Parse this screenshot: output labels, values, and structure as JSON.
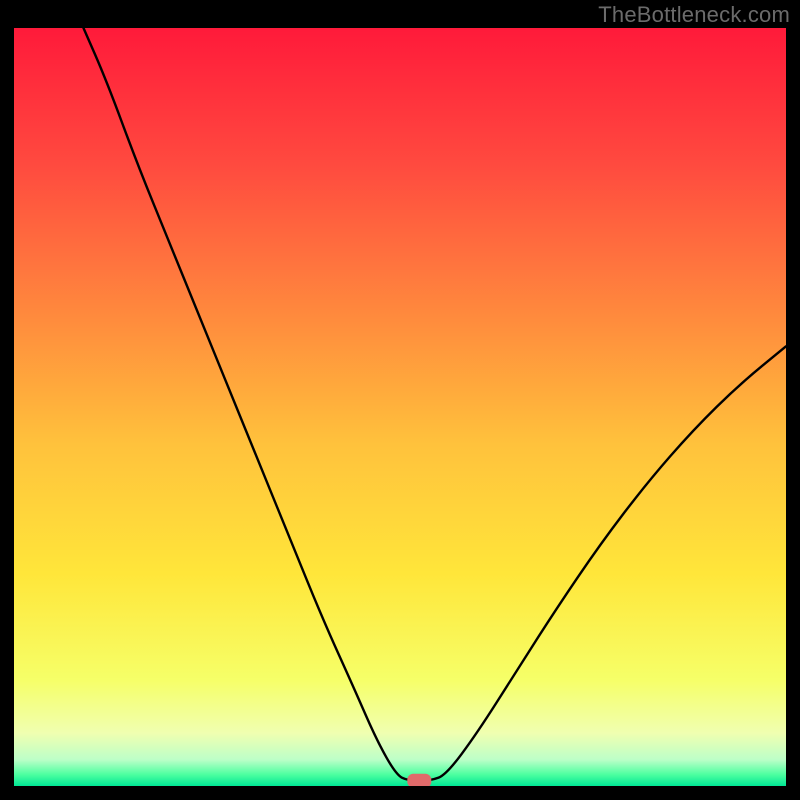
{
  "watermark": "TheBottleneck.com",
  "chart_data": {
    "type": "line",
    "title": "",
    "xlabel": "",
    "ylabel": "",
    "xlim": [
      0,
      100
    ],
    "ylim": [
      0,
      100
    ],
    "gradient_stops": [
      {
        "offset": 0.0,
        "color": "#ff1a3a"
      },
      {
        "offset": 0.18,
        "color": "#ff4a3f"
      },
      {
        "offset": 0.38,
        "color": "#ff8a3d"
      },
      {
        "offset": 0.55,
        "color": "#ffc23c"
      },
      {
        "offset": 0.72,
        "color": "#ffe63a"
      },
      {
        "offset": 0.86,
        "color": "#f6ff68"
      },
      {
        "offset": 0.93,
        "color": "#f0ffb0"
      },
      {
        "offset": 0.965,
        "color": "#bdffc8"
      },
      {
        "offset": 0.985,
        "color": "#4cffa0"
      },
      {
        "offset": 1.0,
        "color": "#00e695"
      }
    ],
    "series": [
      {
        "name": "bottleneck-curve",
        "points": [
          {
            "x": 9,
            "y": 100
          },
          {
            "x": 12,
            "y": 93
          },
          {
            "x": 16,
            "y": 82
          },
          {
            "x": 20,
            "y": 72
          },
          {
            "x": 24,
            "y": 62
          },
          {
            "x": 28,
            "y": 52
          },
          {
            "x": 32,
            "y": 42
          },
          {
            "x": 36,
            "y": 32
          },
          {
            "x": 40,
            "y": 22
          },
          {
            "x": 44,
            "y": 13
          },
          {
            "x": 47,
            "y": 6
          },
          {
            "x": 49.5,
            "y": 1.5
          },
          {
            "x": 51,
            "y": 0.7
          },
          {
            "x": 54,
            "y": 0.7
          },
          {
            "x": 56,
            "y": 1.5
          },
          {
            "x": 60,
            "y": 7
          },
          {
            "x": 65,
            "y": 15
          },
          {
            "x": 70,
            "y": 23
          },
          {
            "x": 76,
            "y": 32
          },
          {
            "x": 82,
            "y": 40
          },
          {
            "x": 88,
            "y": 47
          },
          {
            "x": 94,
            "y": 53
          },
          {
            "x": 100,
            "y": 58
          }
        ]
      }
    ],
    "marker": {
      "x": 52.5,
      "y": 0.7,
      "color": "#e06a6a"
    },
    "colors": {
      "curve": "#000000",
      "background_frame": "#000000"
    }
  }
}
